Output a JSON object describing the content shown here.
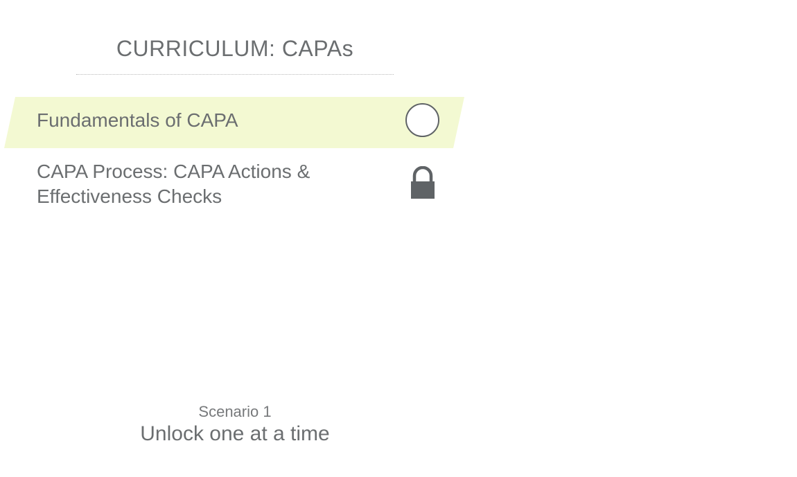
{
  "header": {
    "title": "CURRICULUM: CAPAs"
  },
  "courses": [
    {
      "label": "Fundamentals of CAPA",
      "status": "incomplete",
      "status_icon": "circle-icon",
      "highlighted": true
    },
    {
      "label": "CAPA Process: CAPA Actions & Effectiveness Checks",
      "status": "locked",
      "status_icon": "lock-icon",
      "highlighted": false
    }
  ],
  "footer": {
    "scenario": "Scenario 1",
    "tagline": "Unlock one at a time"
  },
  "colors": {
    "highlight": "#f3f9d2",
    "text": "#6b6e70",
    "icon": "#5f6366"
  }
}
